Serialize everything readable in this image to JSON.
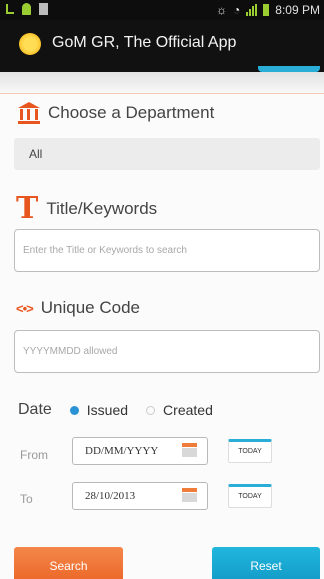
{
  "status_bar": {
    "time": "8:09 PM"
  },
  "app_bar": {
    "title": "GoM GR, The Official App"
  },
  "department": {
    "heading": "Choose a Department",
    "selected": "All"
  },
  "title_search": {
    "heading": "Title/Keywords",
    "placeholder": "Enter the Title or Keywords to search"
  },
  "unique_code": {
    "heading": "Unique Code",
    "placeholder": "YYYYMMDD allowed"
  },
  "date_filter": {
    "label": "Date",
    "options": [
      {
        "label": "Issued",
        "selected": true
      },
      {
        "label": "Created",
        "selected": false
      }
    ],
    "from_label": "From",
    "from_value": "DD/MM/YYYY",
    "to_label": "To",
    "to_value": "28/10/2013",
    "today_label": "TODAY"
  },
  "actions": {
    "search_label": "Search",
    "reset_label": "Reset"
  },
  "colors": {
    "accent_orange": "#e8561f",
    "accent_blue": "#2aaed8",
    "radio_blue": "#2a93d5"
  }
}
